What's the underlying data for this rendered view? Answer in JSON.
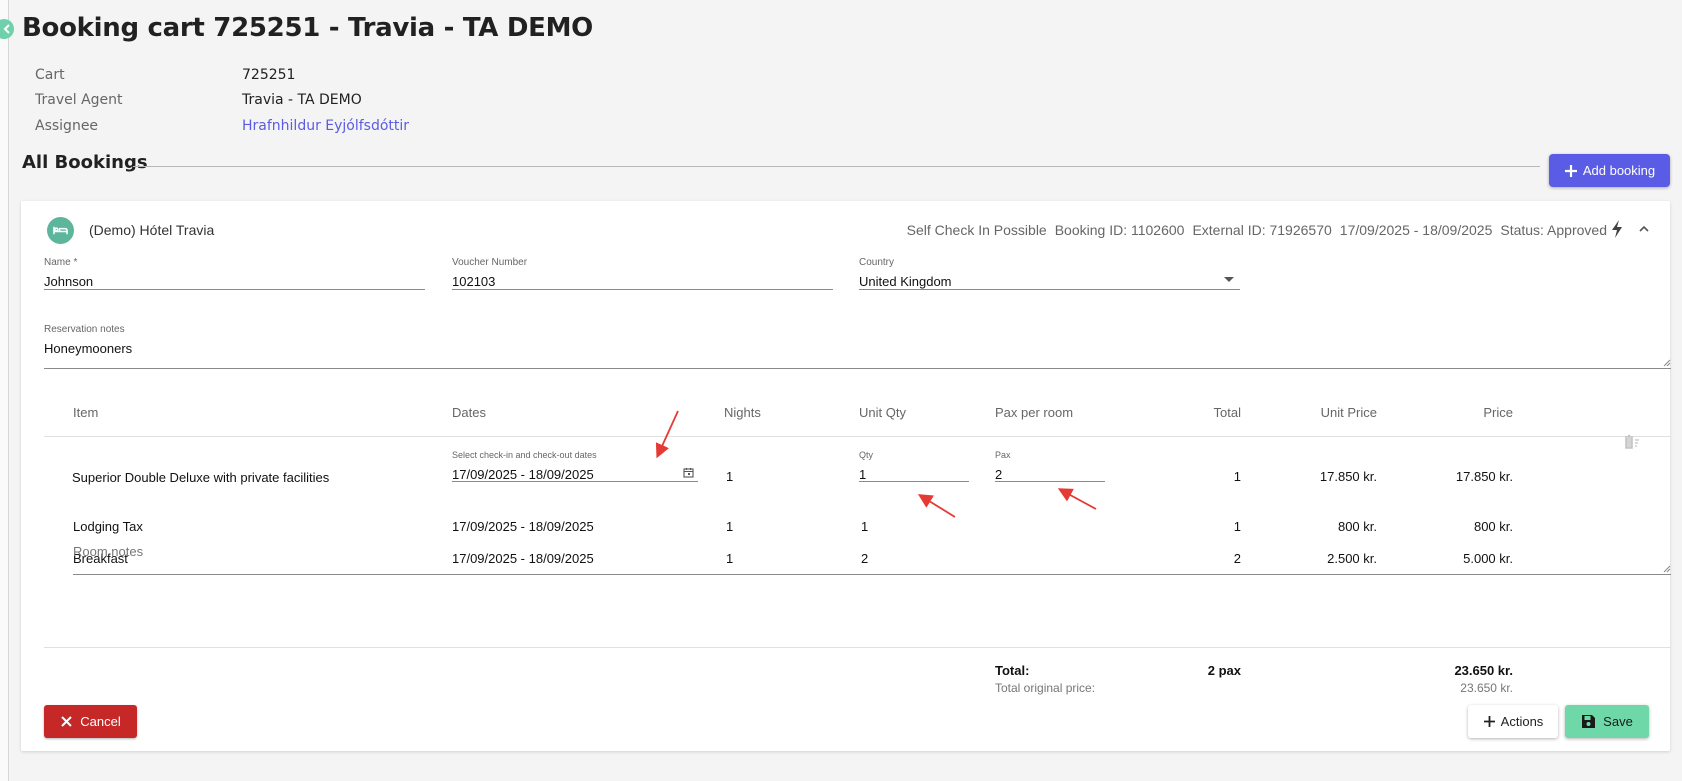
{
  "page": {
    "title": "Booking cart 725251 - Travia - TA DEMO"
  },
  "info": {
    "cart_label": "Cart",
    "cart_value": "725251",
    "agent_label": "Travel Agent",
    "agent_value": "Travia - TA DEMO",
    "assignee_label": "Assignee",
    "assignee_value": "Hrafnhildur Eyjólfsdóttir"
  },
  "bookings": {
    "section_title": "All Bookings",
    "add_label": "Add booking"
  },
  "booking": {
    "hotel_icon": "bed-icon",
    "hotel_name": "(Demo) Hótel Travia",
    "self_check_in": "Self Check In Possible",
    "booking_id": "Booking ID: 1102600",
    "external_id": "External ID: 71926570",
    "date_range": "17/09/2025 - 18/09/2025",
    "status": "Status: Approved",
    "name_label": "Name *",
    "name_value": "Johnson",
    "voucher_label": "Voucher Number",
    "voucher_value": "102103",
    "country_label": "Country",
    "country_value": "United Kingdom",
    "notes_label": "Reservation notes",
    "notes_value": "Honeymooners"
  },
  "table": {
    "headers": {
      "item": "Item",
      "dates": "Dates",
      "nights": "Nights",
      "unit_qty": "Unit Qty",
      "pax_per_room": "Pax per room",
      "total": "Total",
      "unit_price": "Unit Price",
      "price": "Price"
    },
    "room": {
      "item": "Superior Double Deluxe with private facilities",
      "dates_label": "Select check-in and check-out dates",
      "dates_value": "17/09/2025 - 18/09/2025",
      "nights": "1",
      "qty_label": "Qty",
      "qty_value": "1",
      "pax_label": "Pax",
      "pax_value": "2",
      "total": "1",
      "unit_price": "17.850 kr.",
      "price": "17.850 kr."
    },
    "extras": [
      {
        "item": "Lodging Tax",
        "dates": "17/09/2025 - 18/09/2025",
        "nights": "1",
        "unit_qty": "1",
        "total": "1",
        "unit_price": "800 kr.",
        "price": "800 kr."
      },
      {
        "item": "Breakfast",
        "dates": "17/09/2025 - 18/09/2025",
        "nights": "1",
        "unit_qty": "2",
        "total": "2",
        "unit_price": "2.500 kr.",
        "price": "5.000 kr."
      }
    ],
    "room_notes_label": "Room notes"
  },
  "totals": {
    "total_label": "Total:",
    "pax": "2 pax",
    "total_price": "23.650 kr.",
    "original_label": "Total original price:",
    "original_price": "23.650 kr."
  },
  "footer": {
    "cancel_label": "Cancel",
    "actions_label": "Actions",
    "save_label": "Save"
  },
  "colors": {
    "accent": "#5a5ce6",
    "danger": "#c62828",
    "save": "#6fd8a8",
    "annotation_arrow": "#e53935"
  }
}
